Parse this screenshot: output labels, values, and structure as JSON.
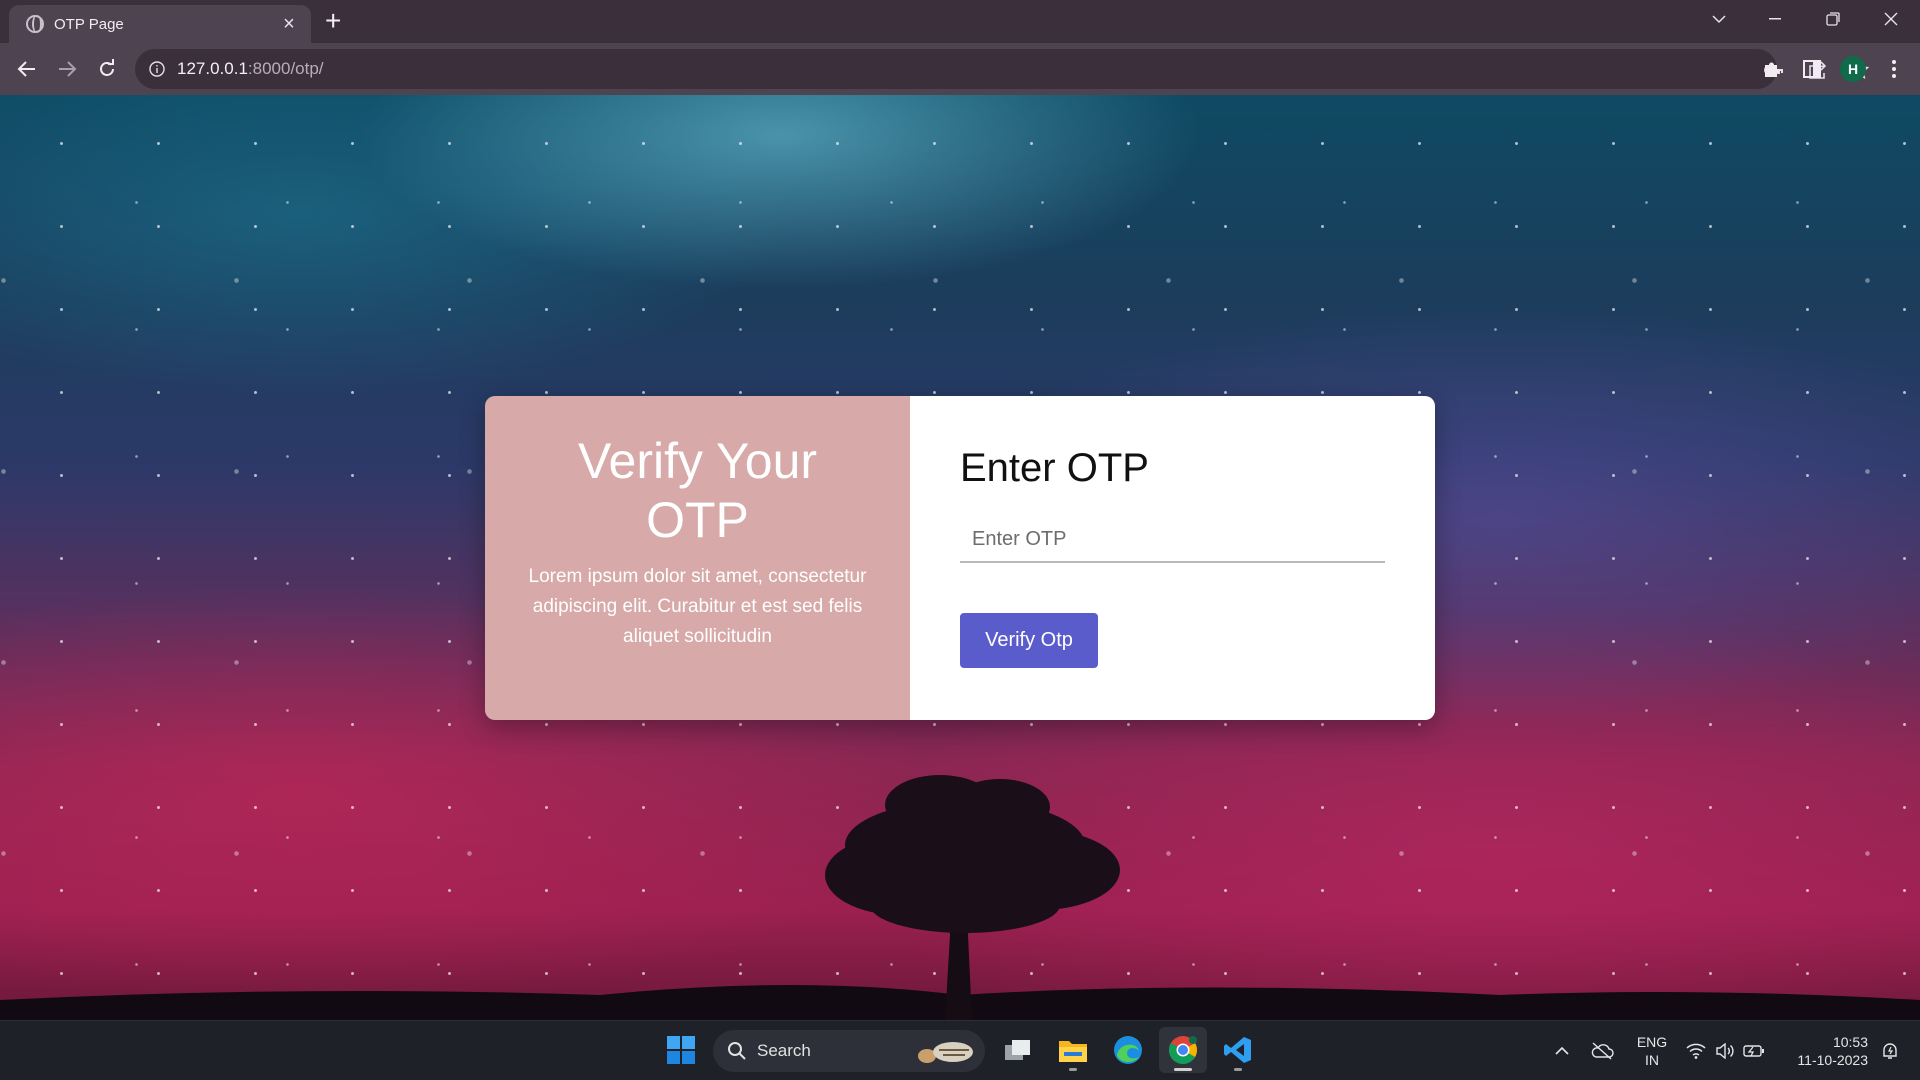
{
  "browser": {
    "tab_title": "OTP Page",
    "url_host": "127.0.0.1",
    "url_path": ":8000/otp/",
    "profile_initial": "H"
  },
  "card": {
    "heading": "Verify Your OTP",
    "description": "Lorem ipsum dolor sit amet, consectetur adipiscing elit. Curabitur et est sed felis aliquet sollicitudin",
    "form_title": "Enter OTP",
    "otp_value": "",
    "otp_placeholder": "Enter OTP",
    "button_label": "Verify Otp",
    "colors": {
      "left_panel": "#d7a9a9",
      "button": "#5a5ccc"
    }
  },
  "taskbar": {
    "search_label": "Search",
    "lang_line1": "ENG",
    "lang_line2": "IN",
    "time": "10:53",
    "date": "11-10-2023",
    "apps": [
      "windows-start",
      "task-view",
      "file-explorer",
      "microsoft-edge",
      "google-chrome",
      "visual-studio-code"
    ]
  }
}
